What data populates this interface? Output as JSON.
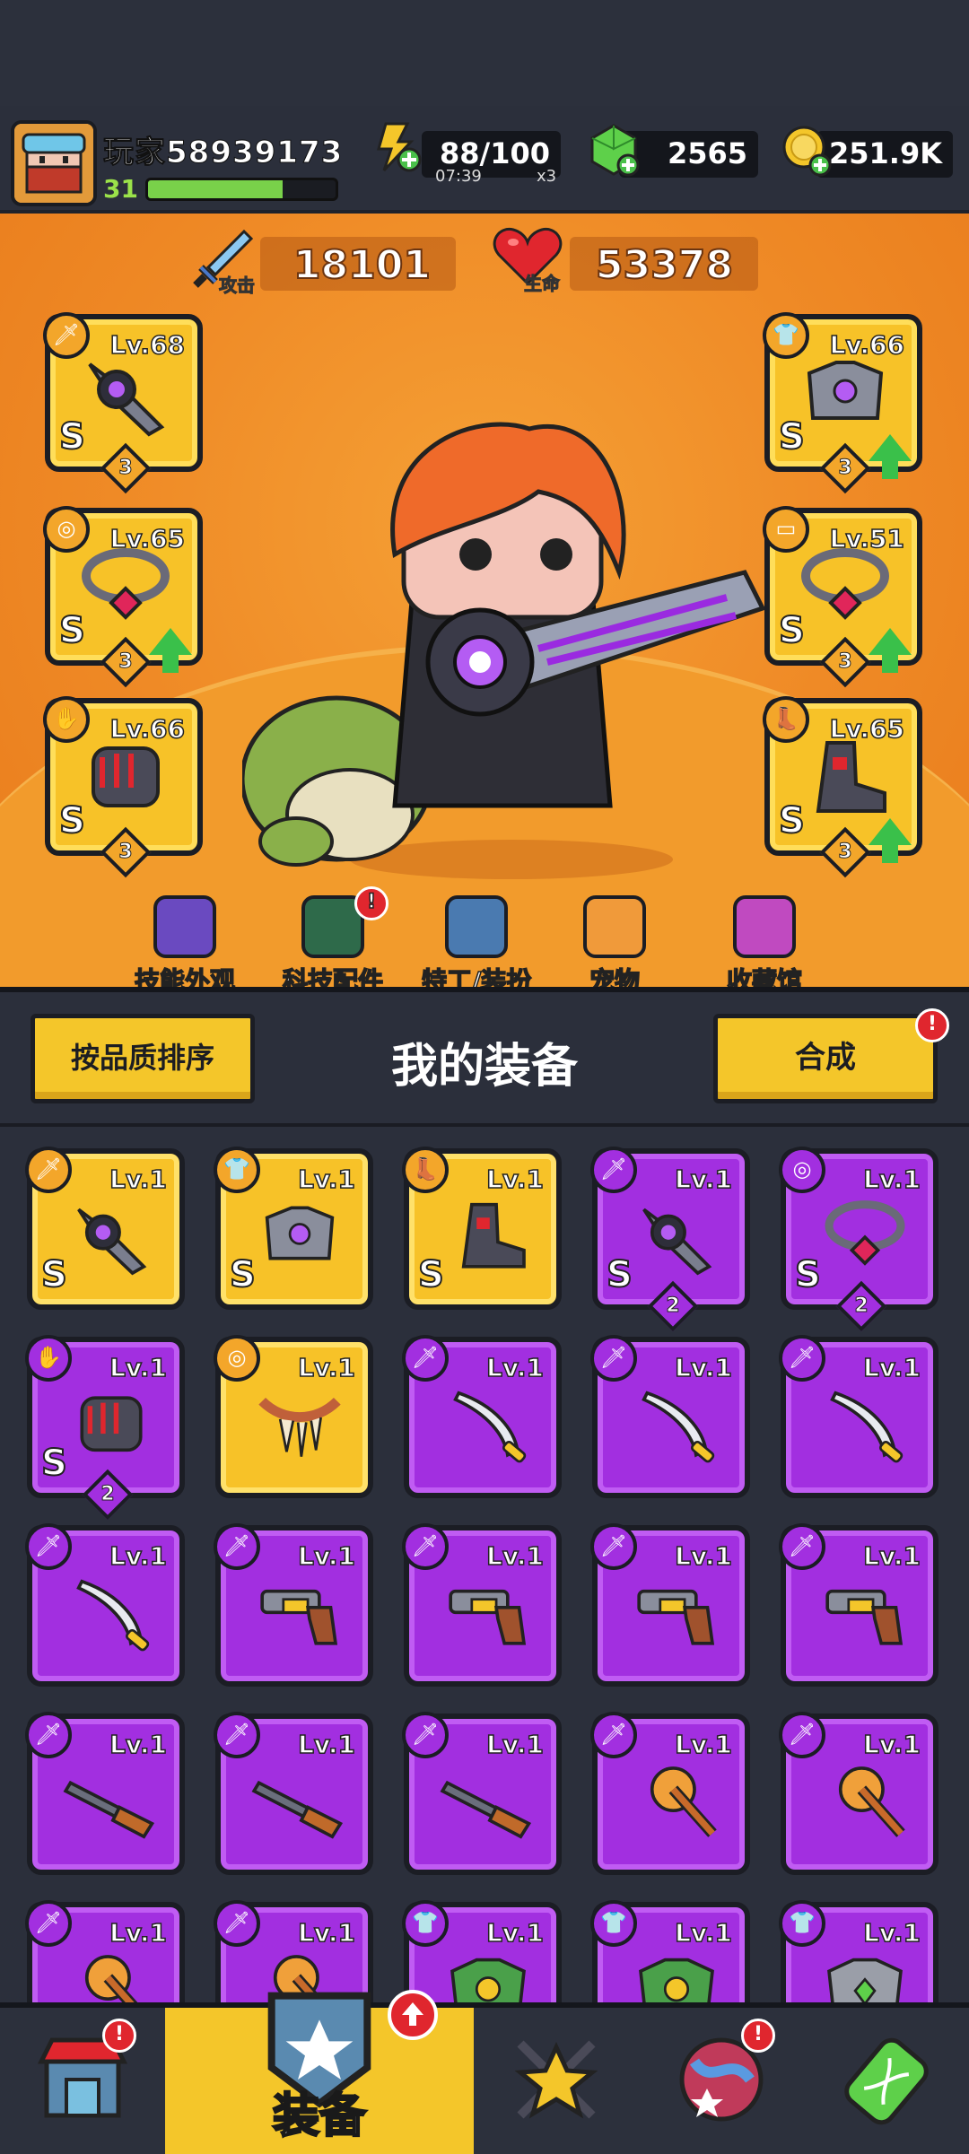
{
  "player": {
    "name": "玩家58939173",
    "level": "31",
    "xp_fraction": 0.72,
    "avatar_icon": "ninja-avatar-icon"
  },
  "resources": {
    "energy": {
      "value": "88/100",
      "timer": "07:39",
      "multiplier": "x3",
      "icon": "energy-bolt-icon"
    },
    "gems": {
      "value": "2565",
      "icon": "green-gem-icon"
    },
    "coins": {
      "value": "251.9K",
      "icon": "gold-coin-icon"
    }
  },
  "stats": {
    "attack": {
      "label": "攻击",
      "value": "18101",
      "icon": "sword-icon"
    },
    "health": {
      "label": "生命",
      "value": "53378",
      "icon": "heart-icon"
    }
  },
  "equipped": {
    "left": [
      {
        "level": "Lv.68",
        "grade": "S",
        "stars": "3",
        "type": "weapon-icon",
        "upgrade": false
      },
      {
        "level": "Lv.65",
        "grade": "S",
        "stars": "3",
        "type": "necklace-icon",
        "upgrade": true
      },
      {
        "level": "Lv.66",
        "grade": "S",
        "stars": "3",
        "type": "glove-icon",
        "upgrade": false
      }
    ],
    "right": [
      {
        "level": "Lv.66",
        "grade": "S",
        "stars": "3",
        "type": "armor-icon",
        "upgrade": true
      },
      {
        "level": "Lv.51",
        "grade": "S",
        "stars": "3",
        "type": "belt-icon",
        "upgrade": true
      },
      {
        "level": "Lv.65",
        "grade": "S",
        "stars": "3",
        "type": "boots-icon",
        "upgrade": true
      }
    ]
  },
  "hero_menu": [
    {
      "label": "技能外观",
      "icon": "skill-skin-icon",
      "alert": false
    },
    {
      "label": "科技配件",
      "icon": "tech-part-icon",
      "alert": true
    },
    {
      "label": "特工/装扮",
      "icon": "agent-icon",
      "alert": false
    },
    {
      "label": "宠物",
      "icon": "pet-icon",
      "alert": false
    },
    {
      "label": "收藏馆",
      "icon": "collection-icon",
      "alert": false
    }
  ],
  "inventory": {
    "title": "我的装备",
    "sort_button": "按品质排序",
    "merge_button": "合成",
    "alert_mark": "!",
    "items": [
      {
        "level": "Lv.1",
        "rarity": "gold",
        "grade": "S",
        "stars": "",
        "type": "weapon-icon",
        "art": "dagger"
      },
      {
        "level": "Lv.1",
        "rarity": "gold",
        "grade": "S",
        "stars": "",
        "type": "armor-icon",
        "art": "armor"
      },
      {
        "level": "Lv.1",
        "rarity": "gold",
        "grade": "S",
        "stars": "",
        "type": "boots-icon",
        "art": "boot"
      },
      {
        "level": "Lv.1",
        "rarity": "purple",
        "grade": "S",
        "stars": "2",
        "type": "weapon-icon",
        "art": "dagger"
      },
      {
        "level": "Lv.1",
        "rarity": "purple",
        "grade": "S",
        "stars": "2",
        "type": "necklace-icon",
        "art": "necklace"
      },
      {
        "level": "Lv.1",
        "rarity": "purple",
        "grade": "S",
        "stars": "2",
        "type": "glove-icon",
        "art": "glove"
      },
      {
        "level": "Lv.1",
        "rarity": "gold",
        "grade": "",
        "stars": "",
        "type": "necklace-icon",
        "art": "fang"
      },
      {
        "level": "Lv.1",
        "rarity": "purple",
        "grade": "",
        "stars": "",
        "type": "weapon-icon",
        "art": "katana"
      },
      {
        "level": "Lv.1",
        "rarity": "purple",
        "grade": "",
        "stars": "",
        "type": "weapon-icon",
        "art": "katana"
      },
      {
        "level": "Lv.1",
        "rarity": "purple",
        "grade": "",
        "stars": "",
        "type": "weapon-icon",
        "art": "katana"
      },
      {
        "level": "Lv.1",
        "rarity": "purple",
        "grade": "",
        "stars": "",
        "type": "weapon-icon",
        "art": "katana"
      },
      {
        "level": "Lv.1",
        "rarity": "purple",
        "grade": "",
        "stars": "",
        "type": "weapon-icon",
        "art": "revolver"
      },
      {
        "level": "Lv.1",
        "rarity": "purple",
        "grade": "",
        "stars": "",
        "type": "weapon-icon",
        "art": "revolver"
      },
      {
        "level": "Lv.1",
        "rarity": "purple",
        "grade": "",
        "stars": "",
        "type": "weapon-icon",
        "art": "revolver"
      },
      {
        "level": "Lv.1",
        "rarity": "purple",
        "grade": "",
        "stars": "",
        "type": "weapon-icon",
        "art": "revolver"
      },
      {
        "level": "Lv.1",
        "rarity": "purple",
        "grade": "",
        "stars": "",
        "type": "weapon-icon",
        "art": "shotgun"
      },
      {
        "level": "Lv.1",
        "rarity": "purple",
        "grade": "",
        "stars": "",
        "type": "weapon-icon",
        "art": "shotgun"
      },
      {
        "level": "Lv.1",
        "rarity": "purple",
        "grade": "",
        "stars": "",
        "type": "weapon-icon",
        "art": "shotgun"
      },
      {
        "level": "Lv.1",
        "rarity": "purple",
        "grade": "",
        "stars": "",
        "type": "weapon-icon",
        "art": "torch"
      },
      {
        "level": "Lv.1",
        "rarity": "purple",
        "grade": "",
        "stars": "",
        "type": "weapon-icon",
        "art": "torch"
      },
      {
        "level": "Lv.1",
        "rarity": "purple",
        "grade": "",
        "stars": "",
        "type": "weapon-icon",
        "art": "torch"
      },
      {
        "level": "Lv.1",
        "rarity": "purple",
        "grade": "",
        "stars": "",
        "type": "weapon-icon",
        "art": "torch"
      },
      {
        "level": "Lv.1",
        "rarity": "purple",
        "grade": "",
        "stars": "",
        "type": "armor-icon",
        "art": "green-armor"
      },
      {
        "level": "Lv.1",
        "rarity": "purple",
        "grade": "",
        "stars": "",
        "type": "armor-icon",
        "art": "green-armor"
      },
      {
        "level": "Lv.1",
        "rarity": "purple",
        "grade": "",
        "stars": "",
        "type": "armor-icon",
        "art": "gray-armor"
      }
    ]
  },
  "bottom_nav": [
    {
      "label": "",
      "icon": "shop-icon",
      "alert": true,
      "active": false
    },
    {
      "label": "装备",
      "icon": "equipment-icon",
      "alert": false,
      "upgrade": true,
      "active": true
    },
    {
      "label": "",
      "icon": "battle-star-icon",
      "alert": false,
      "active": false
    },
    {
      "label": "",
      "icon": "world-ball-icon",
      "alert": true,
      "active": false
    },
    {
      "label": "",
      "icon": "gene-capsule-icon",
      "alert": false,
      "active": false
    }
  ],
  "colors": {
    "gold_card": "#f7c228",
    "purple_card": "#a22fe0",
    "stage_orange": "#ef8a26",
    "alert_red": "#e0262e",
    "upgrade_green": "#3ac04a"
  }
}
